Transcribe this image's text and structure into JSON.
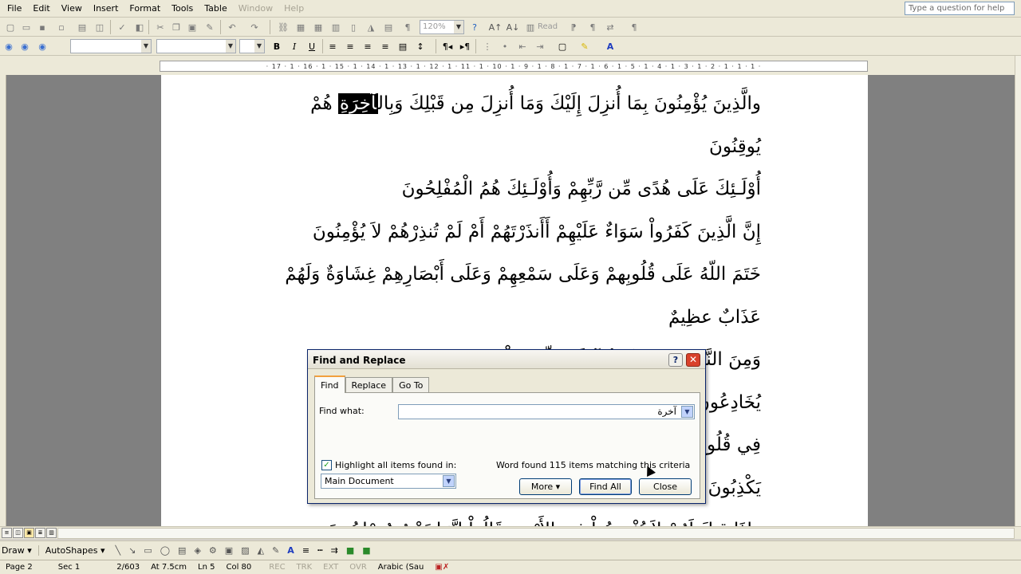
{
  "menu": [
    "File",
    "Edit",
    "View",
    "Insert",
    "Format",
    "Tools",
    "Table",
    "Window",
    "Help"
  ],
  "menu_disabled": [
    "Window",
    "Help"
  ],
  "ask_placeholder": "Type a question for help",
  "toolbar": {
    "zoom": "120%",
    "read": "Read"
  },
  "ruler_text": "· 17 · 1 · 16 · 1 · 15 · 1 · 14 · 1 · 13 · 1 · 12 · 1 · 11 · 1 · 10 · 1 · 9 · 1 · 8 · 1 · 7 · 1 · 6 · 1 · 5 · 1 · 4 · 1 · 3 · 1 · 2 · 1 · 1 · 1 ·",
  "document": {
    "lines": [
      {
        "before": "والَّذِينَ يُؤْمِنُونَ بِمَا أُنزِلَ إِلَيْكَ وَمَا أُنزِلَ مِن قَبْلِكَ وَبِال",
        "highlight": "آخِرَةِ",
        "after": " هُمْ"
      },
      {
        "before": "يُوقِنُونَ",
        "highlight": "",
        "after": ""
      },
      {
        "before": "أُوْلَـئِكَ عَلَى هُدًى مِّن رَّبِّهِمْ وَأُوْلَـئِكَ هُمُ الْمُفْلِحُونَ",
        "highlight": "",
        "after": ""
      },
      {
        "before": "إِنَّ الَّذِينَ كَفَرُواْ سَوَاءٌ عَلَيْهِمْ أَأَنذَرْتَهُمْ أَمْ لَمْ تُنذِرْهُمْ لاَ يُؤْمِنُونَ",
        "highlight": "",
        "after": ""
      },
      {
        "before": "خَتَمَ اللّهُ عَلَى قُلُوبِهمْ وَعَلَى سَمْعِهِمْ وَعَلَى أَبْصَارِهِمْ غِشَاوَةٌ وَلَهُمْ",
        "highlight": "",
        "after": ""
      },
      {
        "before": "عَذَابٌ عظِيمٌ",
        "highlight": "",
        "after": ""
      },
      {
        "before": "وَمِنَ النَّاسِ مَن يَقُولُ آمَنَّا بِاللّهِ وَبِالْيَوْمِ الآخِرِ",
        "highlight": "",
        "after": ""
      },
      {
        "before": "يُخَادِعُونَ اللّهَ وَالَّذِينَ آمَنُوا وَمَا يَخْدَعُونَ",
        "highlight": "",
        "after": ""
      },
      {
        "before": "فِي قُلُوبِهِم مَّرَضٌ فَزَادَهُمُ اللّهُ مَرَضاً",
        "highlight": "",
        "after": ""
      },
      {
        "before": "يَكْذِبُونَ",
        "highlight": "",
        "after": ""
      },
      {
        "before": "وَإِذَا قِيلَ لَهُمْ لاَ تُفْسِدُواْ فِي الأَرْضِ قَالُواْ إِنَّمَا نَحْنُ مُصْلِحُونَ",
        "highlight": "",
        "after": ""
      }
    ]
  },
  "dialog": {
    "title": "Find and Replace",
    "tabs": [
      "Find",
      "Replace",
      "Go To"
    ],
    "find_label": "Find what:",
    "find_value": "آخرة",
    "highlight_label": "Highlight all items found in:",
    "scope": "Main Document",
    "status": "Word found 115 items matching this criteria",
    "buttons": {
      "more": "More ▾",
      "find_all": "Find All",
      "close": "Close"
    }
  },
  "drawbar": {
    "draw": "Draw ▾",
    "autoshapes": "AutoShapes ▾"
  },
  "status": {
    "page": "Page 2",
    "sec": "Sec 1",
    "pos": "2/603",
    "at": "At 7.5cm",
    "ln": "Ln 5",
    "col": "Col 80",
    "rec": "REC",
    "trk": "TRK",
    "ext": "EXT",
    "ovr": "OVR",
    "lang": "Arabic (Sau"
  },
  "colors": {
    "highlight_bg": "#000000",
    "titlebar": "#ece9d8",
    "close_button": "#d9412b"
  }
}
